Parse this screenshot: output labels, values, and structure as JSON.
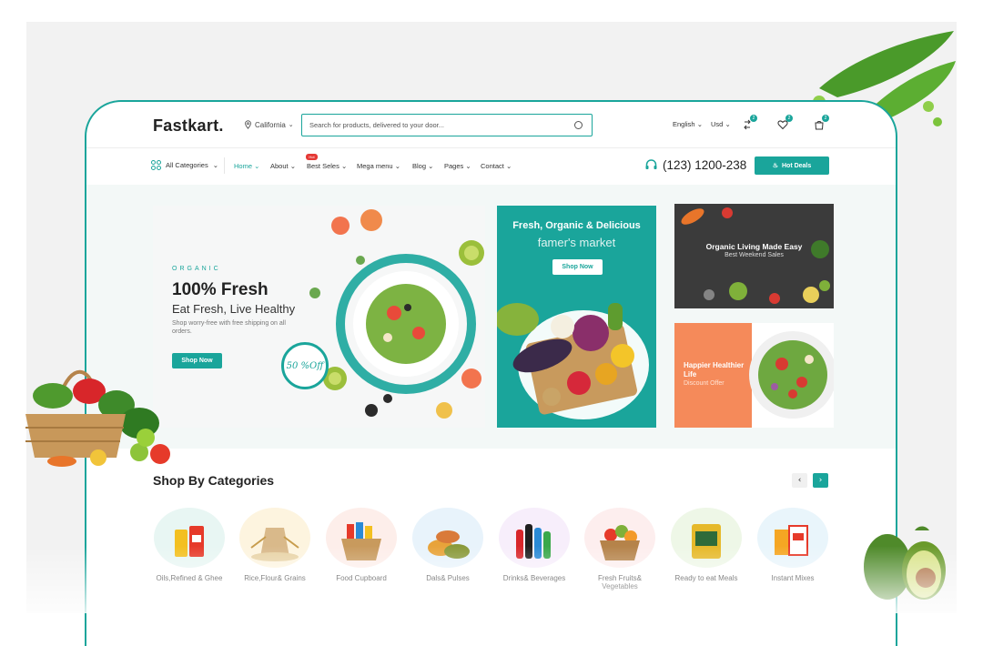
{
  "header": {
    "logo": "Fastkart.",
    "location": "California",
    "search_placeholder": "Search for products, delivered to your door...",
    "language": "English",
    "currency": "Usd",
    "compare_count": "2",
    "wishlist_count": "2",
    "cart_count": "2"
  },
  "nav": {
    "all_categories": "All Categories",
    "items": [
      "Home",
      "About",
      "Best Seles",
      "Mega menu",
      "Blog",
      "Pages",
      "Contact"
    ],
    "hot_tag": "Hot",
    "phone": "(123) 1200-238",
    "hot_deals": "Hot Deals"
  },
  "hero": {
    "tag": "ORGANIC",
    "title": "100% Fresh",
    "subtitle": "Eat Fresh, Live Healthy",
    "description": "Shop worry-free with free shipping on all orders.",
    "button": "Shop Now",
    "badge": "50 %Off"
  },
  "banner_market": {
    "title": "Fresh, Organic & Delicious",
    "subtitle": "famer's market",
    "button": "Shop Now"
  },
  "banner_organic": {
    "title": "Organic Living Made Easy",
    "subtitle": "Best Weekend Sales"
  },
  "banner_happier": {
    "title": "Happier Healthier Life",
    "subtitle": "Discount Offer"
  },
  "categories": {
    "title": "Shop By Categories",
    "items": [
      {
        "label": "Oils,Refined & Ghee",
        "color": "#e8f6f3"
      },
      {
        "label": "Rice,Flour& Grains",
        "color": "#fdf4df"
      },
      {
        "label": "Food Cupboard",
        "color": "#fdeeea"
      },
      {
        "label": "Dals& Pulses",
        "color": "#e8f3fb"
      },
      {
        "label": "Drinks& Beverages",
        "color": "#f7eefb"
      },
      {
        "label": "Fresh Fruits& Vegetables",
        "color": "#fdeeee"
      },
      {
        "label": "Ready to eat Meals",
        "color": "#eef7e7"
      },
      {
        "label": "Instant Mixes",
        "color": "#e9f5fb"
      }
    ]
  },
  "colors": {
    "accent": "#1aa59b",
    "orange": "#f58a5a",
    "dark": "#3b3b3b"
  }
}
